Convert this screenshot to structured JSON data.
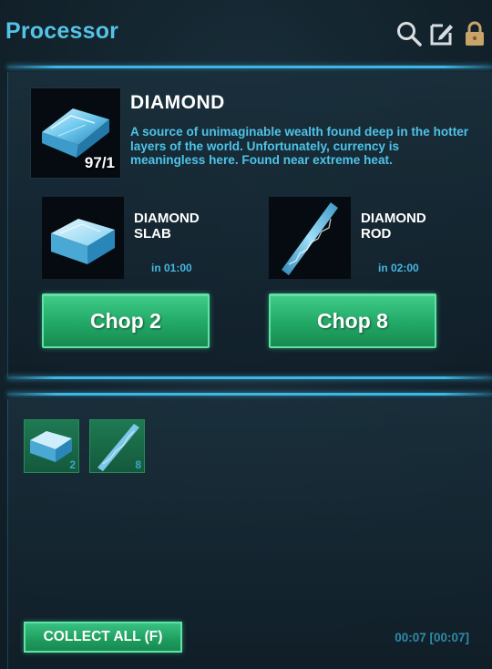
{
  "header": {
    "title": "Processor",
    "icons": [
      "search-icon",
      "edit-icon",
      "lock-icon"
    ]
  },
  "item": {
    "name": "DIAMOND",
    "count": "97/1",
    "description": "A source of unimaginable wealth found deep in the hotter layers of the world. Unfortunately, currency is meaningless here. Found near extreme heat."
  },
  "recipes": [
    {
      "name": "DIAMOND SLAB",
      "time": "in 01:00",
      "button": "Chop 2",
      "icon": "diamond-slab-icon"
    },
    {
      "name": "DIAMOND ROD",
      "time": "in 02:00",
      "button": "Chop 8",
      "icon": "diamond-rod-icon"
    }
  ],
  "output": {
    "slots": [
      {
        "icon": "diamond-slab-icon",
        "count": "2"
      },
      {
        "icon": "diamond-rod-icon",
        "count": "8"
      }
    ],
    "collect_label": "COLLECT ALL (F)",
    "timer": "00:07 [00:07]"
  },
  "colors": {
    "accent": "#55c3e6",
    "button_green": "#22a866",
    "description": "#4ec3e8"
  }
}
